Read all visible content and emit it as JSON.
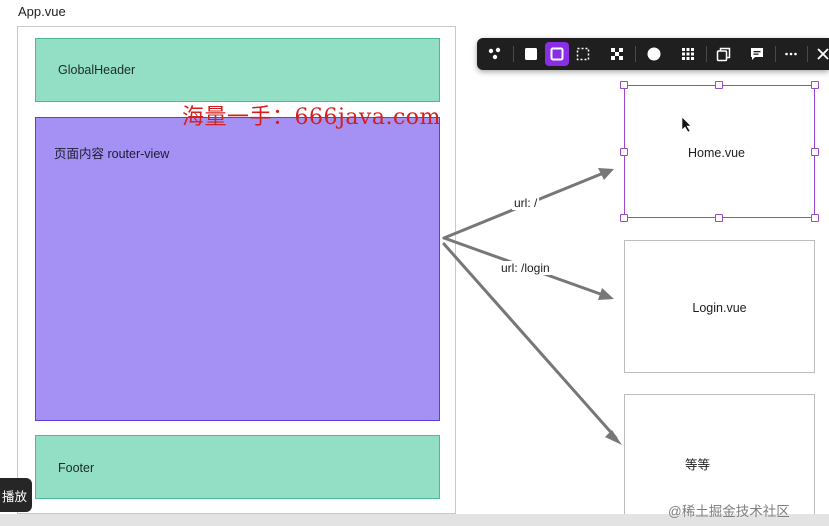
{
  "app": {
    "label": "App.vue"
  },
  "layout": {
    "header_label": "GlobalHeader",
    "content_label": "页面内容 router-view",
    "footer_label": "Footer"
  },
  "pages": {
    "home": "Home.vue",
    "login": "Login.vue",
    "etc": "等等"
  },
  "routes": {
    "home": "url: /",
    "login": "url: /login"
  },
  "watermark": "海量一手：666java.com",
  "toolbar": {
    "icons": [
      "component-icon",
      "fill-square-icon",
      "outline-square-icon",
      "dashed-square-icon",
      "checker-icon",
      "circle-icon",
      "grid-icon",
      "copy-icon",
      "comment-icon",
      "more-icon",
      "close-icon"
    ],
    "active": "outline-square-icon"
  },
  "player": {
    "play_label": "播放"
  },
  "footer_credit": "@稀土掘金技术社区",
  "colors": {
    "header_fill": "#92dfc6",
    "content_fill": "#a491f3",
    "selection": "#9a48d0",
    "toolbar_active": "#8a2ee6",
    "watermark": "#d21f1f"
  }
}
